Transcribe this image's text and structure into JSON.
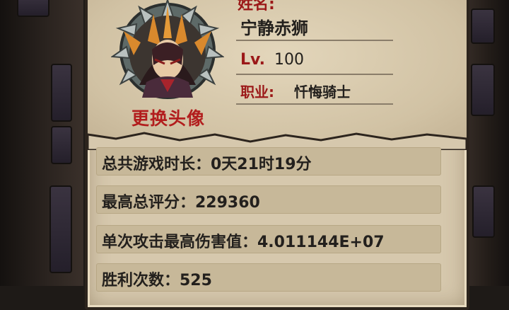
{
  "profile": {
    "name_label": "姓名:",
    "name": "宁静赤狮",
    "level_label": "Lv.",
    "level": "100",
    "job_label": "职业:",
    "job": "忏悔骑士",
    "change_avatar": "更换头像"
  },
  "stats": [
    {
      "text": "总共游戏时长：0天21时19分"
    },
    {
      "text": "最高总评分：229360"
    },
    {
      "text": "单次攻击最高伤害值：4.011144E+07"
    },
    {
      "text": "胜利次数：525"
    }
  ],
  "icons": {
    "avatar": "knight-portrait-icon"
  },
  "colors": {
    "accent_red": "#b21d1d",
    "parchment": "#d6c8ad",
    "frame": "#2c241d"
  }
}
